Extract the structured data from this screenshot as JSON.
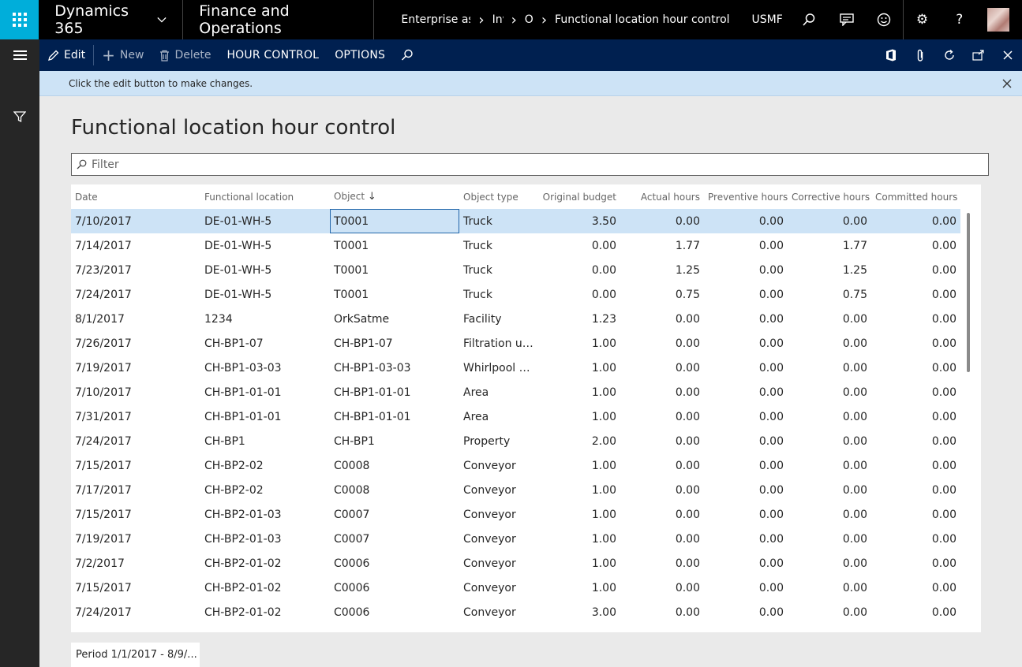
{
  "topbar": {
    "brand": "Dynamics 365",
    "module": "Finance and Operations",
    "breadcrumbs": [
      "Enterprise asse",
      "Inv",
      "O",
      "Functional location hour control"
    ],
    "company": "USMF"
  },
  "actionbar": {
    "edit": "Edit",
    "new": "New",
    "delete": "Delete",
    "hour_control": "HOUR CONTROL",
    "options": "OPTIONS"
  },
  "message": "Click the edit button to make changes.",
  "page_title": "Functional location hour control",
  "filter": {
    "placeholder": "Filter"
  },
  "grid": {
    "columns": [
      "Date",
      "Functional location",
      "Object",
      "Object type",
      "Original budget",
      "Actual hours",
      "Preventive hours",
      "Corrective hours",
      "Committed hours"
    ],
    "sort_indicator": "↓",
    "rows": [
      [
        "7/10/2017",
        "DE-01-WH-5",
        "T0001",
        "Truck",
        "3.50",
        "0.00",
        "0.00",
        "0.00",
        "0.00"
      ],
      [
        "7/14/2017",
        "DE-01-WH-5",
        "T0001",
        "Truck",
        "0.00",
        "1.77",
        "0.00",
        "1.77",
        "0.00"
      ],
      [
        "7/23/2017",
        "DE-01-WH-5",
        "T0001",
        "Truck",
        "0.00",
        "1.25",
        "0.00",
        "1.25",
        "0.00"
      ],
      [
        "7/24/2017",
        "DE-01-WH-5",
        "T0001",
        "Truck",
        "0.00",
        "0.75",
        "0.00",
        "0.75",
        "0.00"
      ],
      [
        "8/1/2017",
        "1234",
        "OrkSatme",
        "Facility",
        "1.23",
        "0.00",
        "0.00",
        "0.00",
        "0.00"
      ],
      [
        "7/26/2017",
        "CH-BP1-07",
        "CH-BP1-07",
        "Filtration unit",
        "1.00",
        "0.00",
        "0.00",
        "0.00",
        "0.00"
      ],
      [
        "7/19/2017",
        "CH-BP1-03-03",
        "CH-BP1-03-03",
        "Whirlpool se...",
        "1.00",
        "0.00",
        "0.00",
        "0.00",
        "0.00"
      ],
      [
        "7/10/2017",
        "CH-BP1-01-01",
        "CH-BP1-01-01",
        "Area",
        "1.00",
        "0.00",
        "0.00",
        "0.00",
        "0.00"
      ],
      [
        "7/31/2017",
        "CH-BP1-01-01",
        "CH-BP1-01-01",
        "Area",
        "1.00",
        "0.00",
        "0.00",
        "0.00",
        "0.00"
      ],
      [
        "7/24/2017",
        "CH-BP1",
        "CH-BP1",
        "Property",
        "2.00",
        "0.00",
        "0.00",
        "0.00",
        "0.00"
      ],
      [
        "7/15/2017",
        "CH-BP2-02",
        "C0008",
        "Conveyor",
        "1.00",
        "0.00",
        "0.00",
        "0.00",
        "0.00"
      ],
      [
        "7/17/2017",
        "CH-BP2-02",
        "C0008",
        "Conveyor",
        "1.00",
        "0.00",
        "0.00",
        "0.00",
        "0.00"
      ],
      [
        "7/15/2017",
        "CH-BP2-01-03",
        "C0007",
        "Conveyor",
        "1.00",
        "0.00",
        "0.00",
        "0.00",
        "0.00"
      ],
      [
        "7/19/2017",
        "CH-BP2-01-03",
        "C0007",
        "Conveyor",
        "1.00",
        "0.00",
        "0.00",
        "0.00",
        "0.00"
      ],
      [
        "7/2/2017",
        "CH-BP2-01-02",
        "C0006",
        "Conveyor",
        "1.00",
        "0.00",
        "0.00",
        "0.00",
        "0.00"
      ],
      [
        "7/15/2017",
        "CH-BP2-01-02",
        "C0006",
        "Conveyor",
        "1.00",
        "0.00",
        "0.00",
        "0.00",
        "0.00"
      ],
      [
        "7/24/2017",
        "CH-BP2-01-02",
        "C0006",
        "Conveyor",
        "3.00",
        "0.00",
        "0.00",
        "0.00",
        "0.00"
      ]
    ]
  },
  "period_label": "Period 1/1/2017 - 8/9/...",
  "colors": {
    "topbar": "#000000",
    "waffle": "#00aeda",
    "actionbar": "#002050",
    "message_bar": "#cde3f6",
    "selected_row": "#cde3f6",
    "rail": "#262626"
  }
}
